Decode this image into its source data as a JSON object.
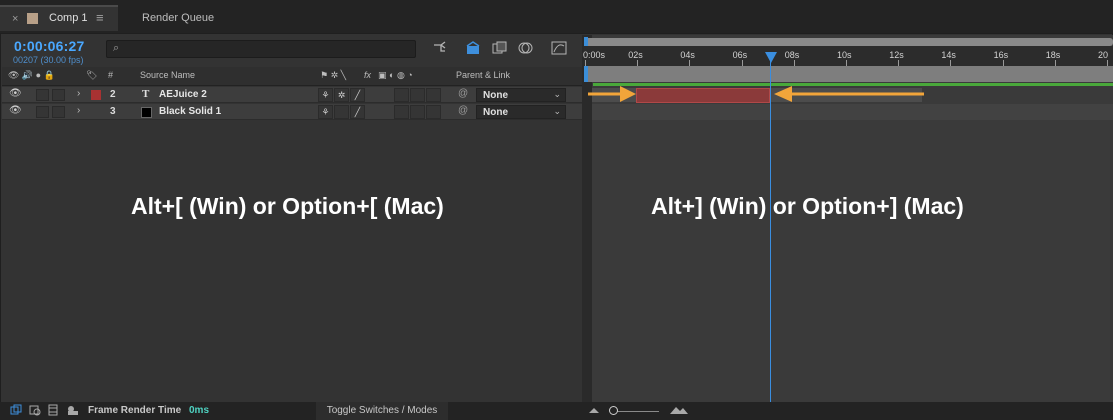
{
  "tabs": {
    "close": "×",
    "comp_label": "Comp 1",
    "menu": "≡",
    "render_queue": "Render Queue"
  },
  "composition": {
    "timecode": "0:00:06:27",
    "frame_info": "00207 (30.00 fps)",
    "search_icon": "⌕",
    "search_placeholder": ""
  },
  "columns": {
    "source_name": "Source Name",
    "number": "#",
    "parent_link": "Parent & Link",
    "fx": "fx"
  },
  "layers": [
    {
      "number": "2",
      "type_glyph": "T",
      "name": "AEJuice 2",
      "label_color": "#a83232",
      "parent": "None"
    },
    {
      "number": "3",
      "type_glyph": "",
      "name": "Black Solid 1",
      "label_color": "#000000",
      "parent": "None"
    }
  ],
  "ruler": {
    "labels": [
      "0:00s",
      "02s",
      "04s",
      "06s",
      "08s",
      "10s",
      "12s",
      "14s",
      "16s",
      "18s",
      "20"
    ]
  },
  "captions": {
    "left": "Alt+[ (Win) or Option+[ (Mac)",
    "right": "Alt+] (Win) or Option+] (Mac)"
  },
  "bottom": {
    "frame_render_label": "Frame Render Time",
    "frame_render_value": "0ms",
    "toggle_label": "Toggle Switches / Modes"
  },
  "colors": {
    "accent_blue": "#3a8ee0",
    "arrow_orange": "#f2a53a",
    "layer_bar": "#8b3a3a"
  }
}
